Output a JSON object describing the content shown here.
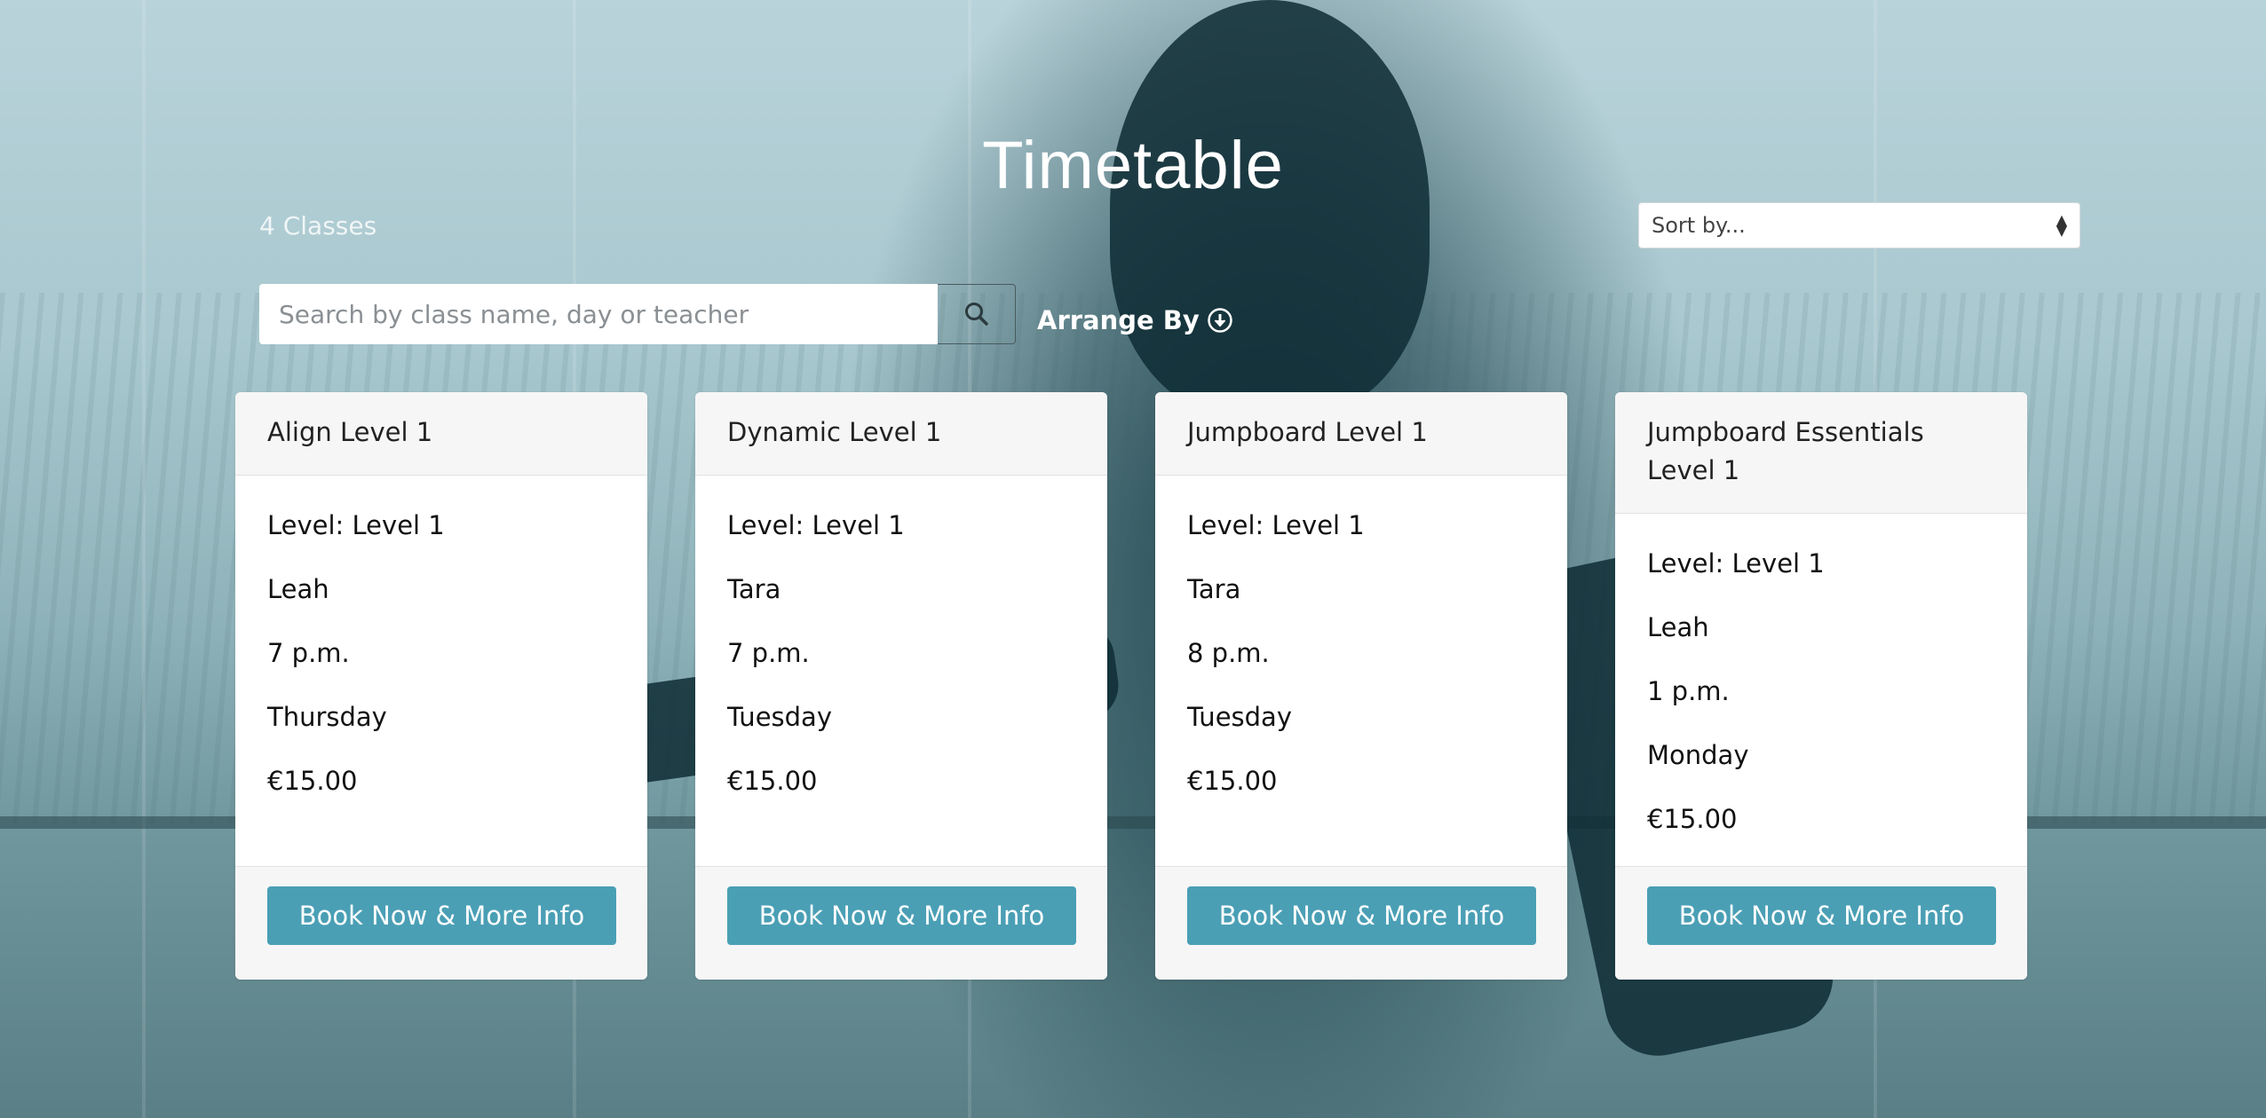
{
  "page": {
    "title": "Timetable",
    "class_count": "4 Classes"
  },
  "sort": {
    "label": "Sort by..."
  },
  "search": {
    "placeholder": "Search by class name, day or teacher",
    "value": ""
  },
  "arrange": {
    "label": "Arrange By"
  },
  "colors": {
    "button": "#4a9fb5",
    "card_header": "#f6f6f6"
  },
  "classes": [
    {
      "name": "Align Level 1",
      "level": "Level: Level 1",
      "teacher": "Leah",
      "time": "7 p.m.",
      "day": "Thursday",
      "price": "€15.00",
      "button_label": "Book Now & More Info"
    },
    {
      "name": "Dynamic Level 1",
      "level": "Level: Level 1",
      "teacher": "Tara",
      "time": "7 p.m.",
      "day": "Tuesday",
      "price": "€15.00",
      "button_label": "Book Now & More Info"
    },
    {
      "name": "Jumpboard Level 1",
      "level": "Level: Level 1",
      "teacher": "Tara",
      "time": "8 p.m.",
      "day": "Tuesday",
      "price": "€15.00",
      "button_label": "Book Now & More Info"
    },
    {
      "name": "Jumpboard Essentials Level 1",
      "level": "Level: Level 1",
      "teacher": "Leah",
      "time": "1 p.m.",
      "day": "Monday",
      "price": "€15.00",
      "button_label": "Book Now & More Info"
    }
  ]
}
